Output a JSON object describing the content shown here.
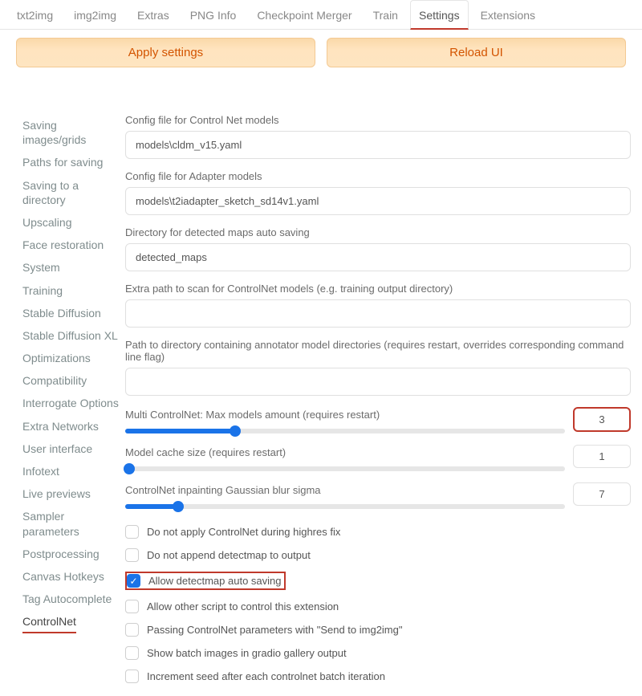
{
  "tabs": [
    "txt2img",
    "img2img",
    "Extras",
    "PNG Info",
    "Checkpoint Merger",
    "Train",
    "Settings",
    "Extensions"
  ],
  "active_tab": "Settings",
  "buttons": {
    "apply": "Apply settings",
    "reload": "Reload UI"
  },
  "sidebar": {
    "items": [
      "Saving images/grids",
      "Paths for saving",
      "Saving to a directory",
      "Upscaling",
      "Face restoration",
      "System",
      "Training",
      "Stable Diffusion",
      "Stable Diffusion XL",
      "Optimizations",
      "Compatibility",
      "Interrogate Options",
      "Extra Networks",
      "User interface",
      "Infotext",
      "Live previews",
      "Sampler parameters",
      "Postprocessing",
      "Canvas Hotkeys",
      "Tag Autocomplete",
      "ControlNet"
    ],
    "active": "ControlNet"
  },
  "fields": {
    "cn_config": {
      "label": "Config file for Control Net models",
      "value": "models\\cldm_v15.yaml"
    },
    "adapter_config": {
      "label": "Config file for Adapter models",
      "value": "models\\t2iadapter_sketch_sd14v1.yaml"
    },
    "detected_dir": {
      "label": "Directory for detected maps auto saving",
      "value": "detected_maps"
    },
    "extra_path": {
      "label": "Extra path to scan for ControlNet models (e.g. training output directory)",
      "value": ""
    },
    "annotator_dir": {
      "label": "Path to directory containing annotator model directories (requires restart, overrides corresponding command line flag)",
      "value": ""
    },
    "multi_cn": {
      "label": "Multi ControlNet: Max models amount (requires restart)",
      "value": "3",
      "fill": 25
    },
    "cache_size": {
      "label": "Model cache size (requires restart)",
      "value": "1",
      "fill": 1
    },
    "gauss_sigma": {
      "label": "ControlNet inpainting Gaussian blur sigma",
      "value": "7",
      "fill": 12
    }
  },
  "checks": [
    {
      "label": "Do not apply ControlNet during highres fix",
      "checked": false,
      "highlight": false
    },
    {
      "label": "Do not append detectmap to output",
      "checked": false,
      "highlight": false
    },
    {
      "label": "Allow detectmap auto saving",
      "checked": true,
      "highlight": true
    },
    {
      "label": "Allow other script to control this extension",
      "checked": false,
      "highlight": false
    },
    {
      "label": "Passing ControlNet parameters with \"Send to img2img\"",
      "checked": false,
      "highlight": false
    },
    {
      "label": "Show batch images in gradio gallery output",
      "checked": false,
      "highlight": false
    },
    {
      "label": "Increment seed after each controlnet batch iteration",
      "checked": false,
      "highlight": false
    }
  ]
}
